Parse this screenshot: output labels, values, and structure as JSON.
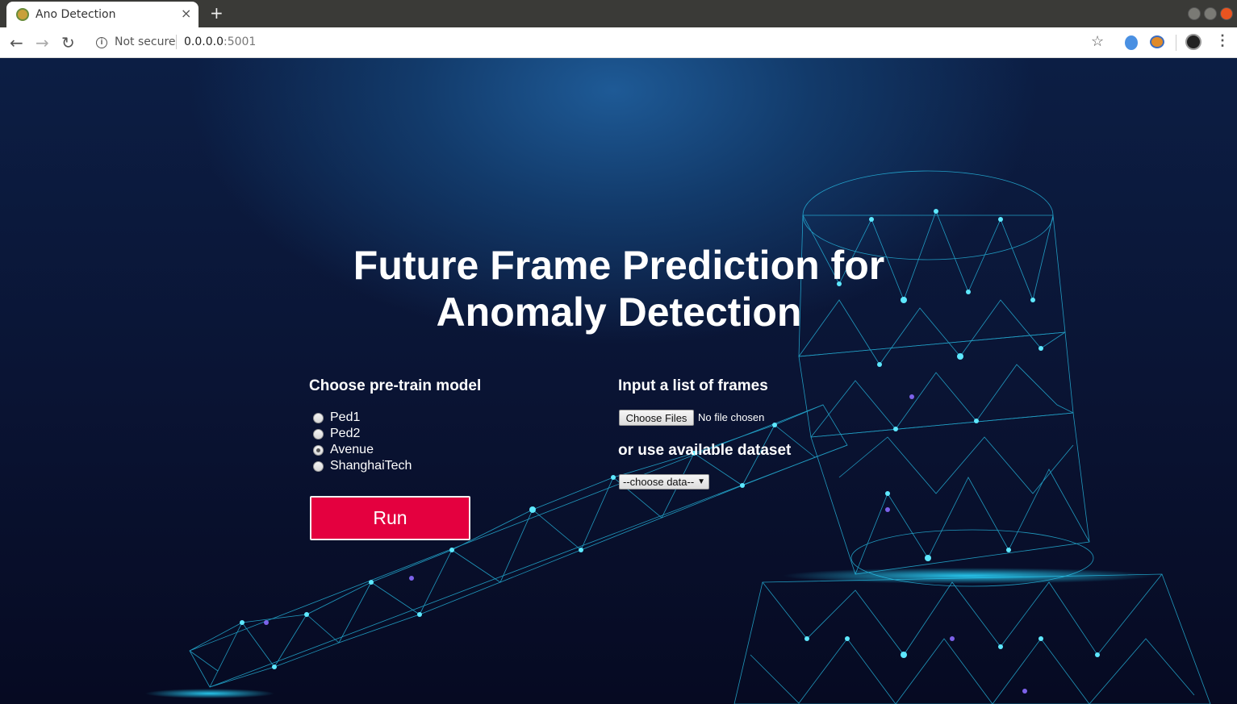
{
  "browser": {
    "tab_title": "Ano Detection",
    "tab_close": "×",
    "new_tab": "+",
    "security_label": "Not secure",
    "url_host": "0.0.0.0",
    "url_port": ":5001"
  },
  "header": {
    "title_line1": "Future Frame Prediction for",
    "title_line2": "Anomaly Detection"
  },
  "model_section": {
    "label": "Choose pre-train model",
    "options": [
      {
        "label": "Ped1",
        "checked": false
      },
      {
        "label": "Ped2",
        "checked": false
      },
      {
        "label": "Avenue",
        "checked": true
      },
      {
        "label": "ShanghaiTech",
        "checked": false
      }
    ],
    "run_label": "Run"
  },
  "frames_section": {
    "label": "Input a list of frames",
    "file_button": "Choose Files",
    "file_status": "No file chosen",
    "dataset_label": "or use available dataset",
    "dataset_select": "--choose data--"
  },
  "colors": {
    "run_button": "#e4003f",
    "background": "#0a1434",
    "network_glow": "#29d3ff"
  }
}
